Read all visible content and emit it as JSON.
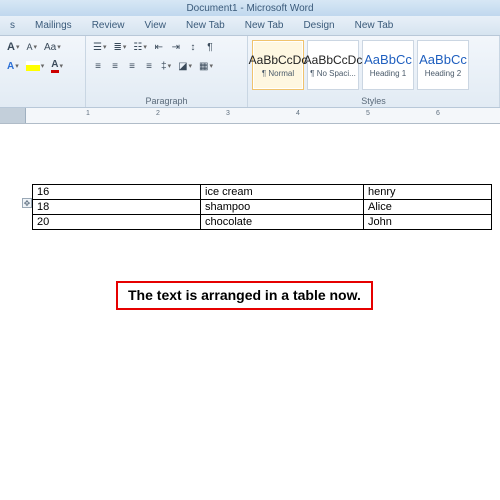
{
  "app": {
    "title": "Document1 - Microsoft Word"
  },
  "tabs": [
    "s",
    "Mailings",
    "Review",
    "View",
    "New Tab",
    "New Tab",
    "Design",
    "New Tab"
  ],
  "ribbon": {
    "paragraph_label": "Paragraph",
    "styles_label": "Styles"
  },
  "styles": [
    {
      "sample": "AaBbCcDc",
      "name": "¶ Normal",
      "active": true,
      "blue": false
    },
    {
      "sample": "AaBbCcDc",
      "name": "¶ No Spaci...",
      "active": false,
      "blue": false
    },
    {
      "sample": "AaBbCc",
      "name": "Heading 1",
      "active": false,
      "blue": true
    },
    {
      "sample": "AaBbCc",
      "name": "Heading 2",
      "active": false,
      "blue": true
    }
  ],
  "ruler_numbers": [
    "1",
    "2",
    "3",
    "4",
    "5",
    "6"
  ],
  "table": {
    "rows": [
      [
        "16",
        "ice cream",
        "henry"
      ],
      [
        "18",
        "shampoo",
        "Alice"
      ],
      [
        "20",
        "chocolate",
        "John"
      ]
    ]
  },
  "callout": "The text is arranged in a table now.",
  "font_letter": "A"
}
